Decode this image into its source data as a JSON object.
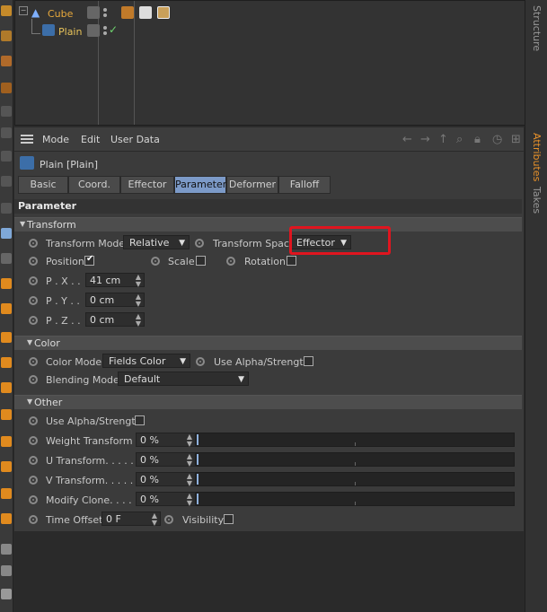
{
  "object_manager": {
    "objects": [
      {
        "name": "Cube",
        "color": "#e8a93c"
      },
      {
        "name": "Plain",
        "color": "#e8c35a"
      }
    ]
  },
  "right_tabs": [
    "Structure",
    "Attributes",
    "Takes"
  ],
  "attributes": {
    "menu": [
      "Mode",
      "Edit",
      "User Data"
    ],
    "object_title": "Plain [Plain]",
    "tabs": [
      "Basic",
      "Coord.",
      "Effector",
      "Parameter",
      "Deformer",
      "Falloff"
    ],
    "active_tab": "Parameter",
    "section_title": "Parameter",
    "transform": {
      "header": "Transform",
      "transform_mode_label": "Transform Mode",
      "transform_mode_value": "Relative",
      "transform_space_label": "Transform Space",
      "transform_space_value": "Effector",
      "position_label": "Position",
      "scale_label": "Scale",
      "rotation_label": "Rotation",
      "px_label": "P . X . .",
      "px_value": "41 cm",
      "py_label": "P . Y . .",
      "py_value": "0 cm",
      "pz_label": "P . Z . .",
      "pz_value": "0 cm"
    },
    "color": {
      "header": "Color",
      "color_mode_label": "Color Mode",
      "color_mode_value": "Fields Color",
      "use_alpha_label": "Use Alpha/Strength",
      "blending_mode_label": "Blending Mode",
      "blending_mode_value": "Default"
    },
    "other": {
      "header": "Other",
      "use_alpha_label": "Use Alpha/Strength",
      "weight_label": "Weight Transform",
      "weight_value": "0 %",
      "u_label": "U Transform. . . . .",
      "u_value": "0 %",
      "v_label": "V Transform. . . . .",
      "v_value": "0 %",
      "modify_label": "Modify Clone. . . . .",
      "modify_value": "0 %",
      "time_offset_label": "Time Offset",
      "time_offset_value": "0 F",
      "visibility_label": "Visibility"
    }
  },
  "colors": {
    "accent": "#7c9ac8",
    "highlight": "#e0151f"
  }
}
